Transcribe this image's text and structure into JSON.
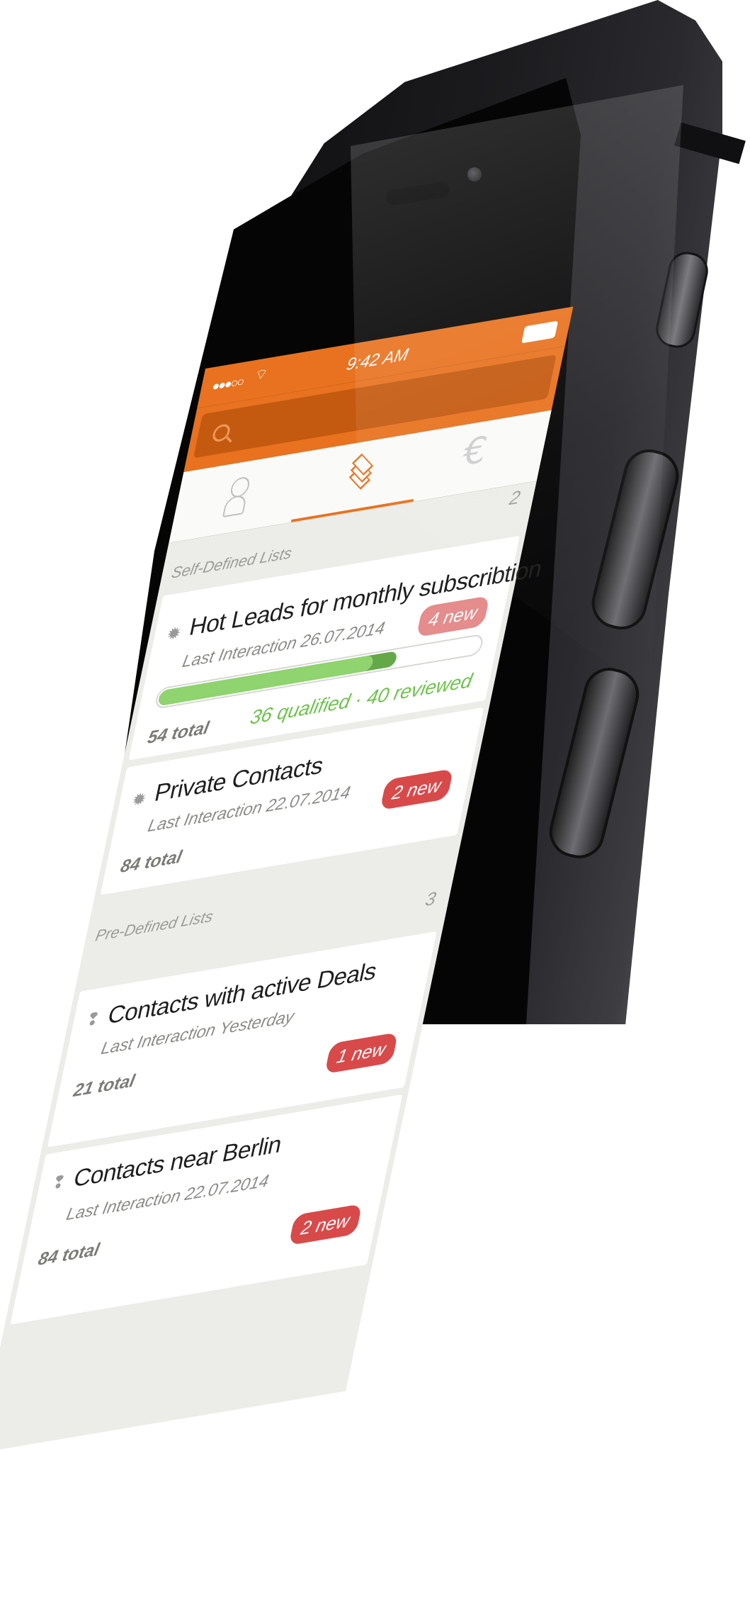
{
  "status_bar": {
    "signal": "●●●○○",
    "wifi_icon": "wifi-icon",
    "time": "9:42 AM",
    "battery_icon": "battery-icon"
  },
  "search": {
    "placeholder": "",
    "icon": "search-icon"
  },
  "tabs": [
    {
      "icon": "contact-icon",
      "active": false
    },
    {
      "icon": "layers-icon",
      "active": true
    },
    {
      "icon": "euro-icon",
      "active": false,
      "glyph": "€"
    }
  ],
  "self_defined": {
    "title": "Self-Defined Lists",
    "count": "2",
    "cards": [
      {
        "icon": "gear-icon",
        "title": "Hot Leads for monthly subscribtion",
        "last_interaction": "Last Interaction 26.07.2014",
        "badge": "4 new",
        "total": "54 total",
        "qualified": "36 qualified",
        "separator": "·",
        "reviewed": "40 reviewed",
        "progress_qualified": 36,
        "progress_reviewed": 40,
        "progress_total": 54
      },
      {
        "icon": "gear-icon",
        "title": "Private Contacts",
        "last_interaction": "Last Interaction 22.07.2014",
        "badge": "2 new",
        "total": "84 total"
      }
    ]
  },
  "pre_defined": {
    "title": "Pre-Defined Lists",
    "count": "3",
    "cards": [
      {
        "icon": "bulb-icon",
        "title": "Contacts with active Deals",
        "last_interaction": "Last Interaction Yesterday",
        "badge": "1 new",
        "total": "21 total"
      },
      {
        "icon": "bulb-icon",
        "title": "Contacts near Berlin",
        "last_interaction": "Last Interaction 22.07.2014",
        "badge": "2 new",
        "total": "84 total"
      }
    ]
  },
  "colors": {
    "accent": "#e8721f",
    "badge": "#d84a4a",
    "progress_reviewed": "#65a84a",
    "progress_qualified": "#8fd46e"
  }
}
